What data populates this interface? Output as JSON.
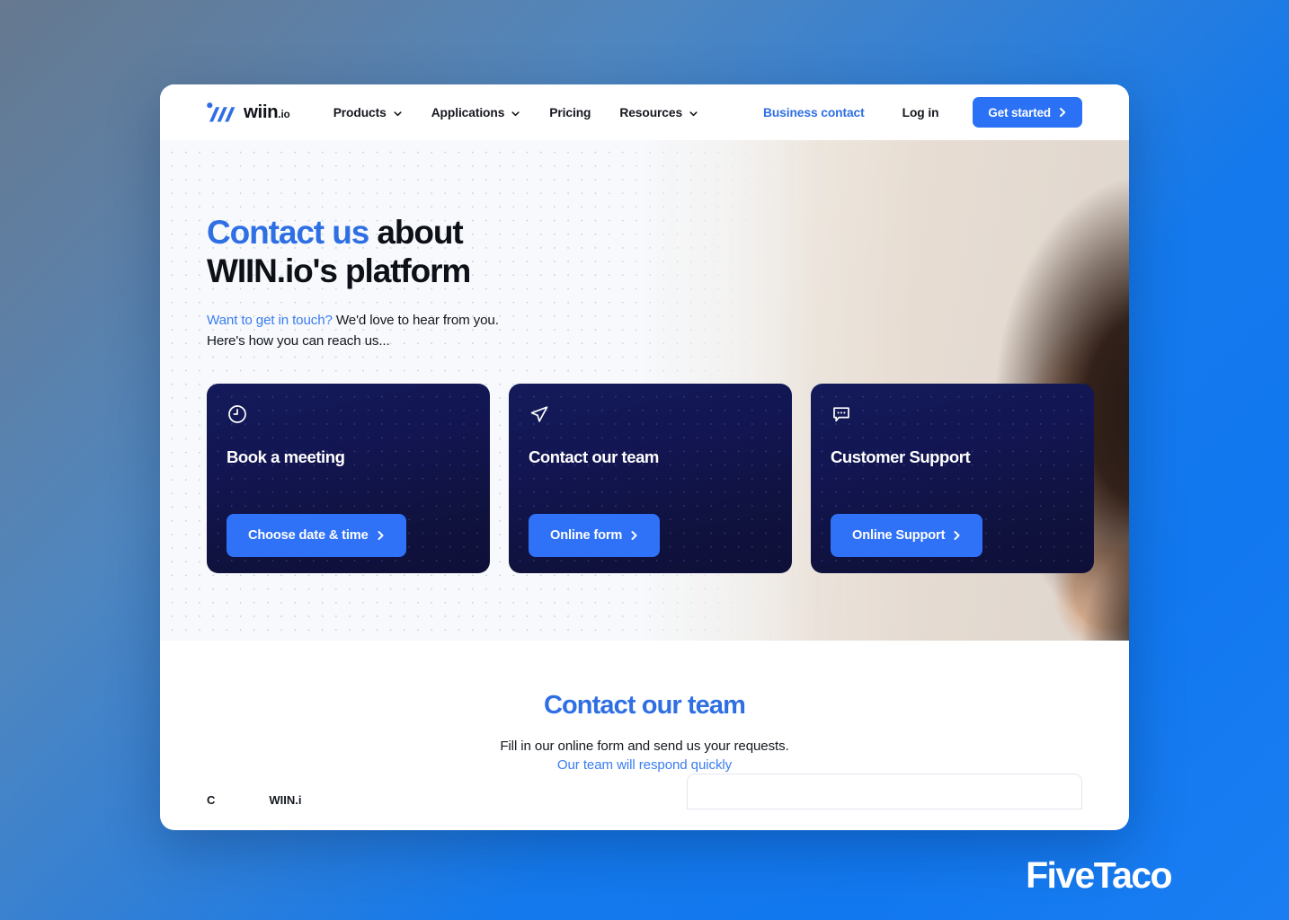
{
  "nav": {
    "logo": {
      "name": "wiin",
      "tld": ".io",
      "icon": "wiin-logo-mark"
    },
    "links": [
      {
        "label": "Products",
        "has_dropdown": true
      },
      {
        "label": "Applications",
        "has_dropdown": true
      },
      {
        "label": "Pricing",
        "has_dropdown": false
      },
      {
        "label": "Resources",
        "has_dropdown": true
      }
    ],
    "business_contact": "Business contact",
    "log_in": "Log in",
    "get_started": "Get started"
  },
  "hero": {
    "title_accent": "Contact us",
    "title_rest": " about WIIN.io's platform",
    "sub_accent": "Want to get in touch?",
    "sub_rest": " We'd love to hear from you.",
    "sub_line2": "Here's how you can reach us...",
    "photo_alt": "woman working on a laptop by a window"
  },
  "cards": [
    {
      "icon": "clock-icon",
      "title": "Book a meeting",
      "button": "Choose date & time"
    },
    {
      "icon": "send-icon",
      "title": "Contact our team",
      "button": "Online form"
    },
    {
      "icon": "chat-bubble-icon",
      "title": "Customer Support",
      "button": "Online Support"
    }
  ],
  "lower": {
    "title": "Contact our team",
    "sub": "Fill in our online form and send us your requests.",
    "sub2": "Our team will respond quickly",
    "cut_label_1": "C",
    "cut_label_2": "WIIN.i"
  },
  "watermark": "FiveTaco",
  "colors": {
    "brand_blue": "#2b71f5",
    "link_blue": "#2f6fe4",
    "accent_blue": "#3b7df0",
    "card_navy": "#111544",
    "text_dark": "#0d1117",
    "page_bg_top_left": "#66798f",
    "page_bg_bottom_right": "#1a7ef2"
  }
}
